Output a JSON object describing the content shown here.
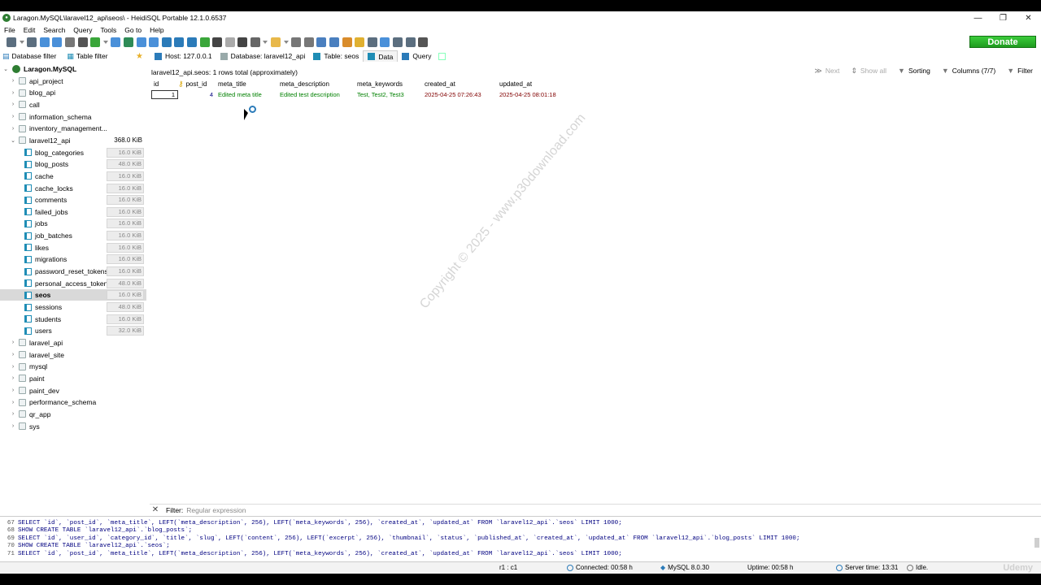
{
  "window": {
    "title": "Laragon.MySQL\\laravel12_api\\seos\\ - HeidiSQL Portable 12.1.0.6537"
  },
  "menu": [
    "File",
    "Edit",
    "Search",
    "Query",
    "Tools",
    "Go to",
    "Help"
  ],
  "toolbar": {
    "donate_label": "Donate",
    "icons": [
      {
        "name": "connect-icon",
        "color": "#5b6e7f"
      },
      {
        "name": "dropdown-icon",
        "color": "#888888"
      },
      {
        "name": "disconnect-icon",
        "color": "#5b6e7f"
      },
      {
        "name": "copy-icon",
        "color": "#4a90d9"
      },
      {
        "name": "paste-icon",
        "color": "#4a90d9"
      },
      {
        "name": "undo-icon",
        "color": "#777777"
      },
      {
        "name": "print-icon",
        "color": "#555555"
      },
      {
        "name": "refresh-icon",
        "color": "#3aa63a"
      },
      {
        "name": "dropdown-icon",
        "color": "#888888"
      },
      {
        "name": "user-manager-icon",
        "color": "#4a90d9"
      },
      {
        "name": "export-icon",
        "color": "#2e8b57"
      },
      {
        "name": "import-icon",
        "color": "#4a90d9"
      },
      {
        "name": "transfer-icon",
        "color": "#4a90d9"
      },
      {
        "name": "help-icon",
        "color": "#2b7bb9"
      },
      {
        "name": "first-icon",
        "color": "#2b7bb9"
      },
      {
        "name": "last-icon",
        "color": "#2b7bb9"
      },
      {
        "name": "add-icon",
        "color": "#3aa63a"
      },
      {
        "name": "delete-icon",
        "color": "#444444"
      },
      {
        "name": "post-icon",
        "color": "#aaaaaa"
      },
      {
        "name": "cancel-icon",
        "color": "#444444"
      },
      {
        "name": "run-icon",
        "color": "#666666"
      },
      {
        "name": "dropdown-icon",
        "color": "#888888"
      },
      {
        "name": "folder-icon",
        "color": "#e8b84a"
      },
      {
        "name": "dropdown-icon",
        "color": "#888888"
      },
      {
        "name": "save-icon",
        "color": "#777777"
      },
      {
        "name": "save-as-icon",
        "color": "#777777"
      },
      {
        "name": "search-icon",
        "color": "#4a7fbf"
      },
      {
        "name": "replace-icon",
        "color": "#4a7fbf"
      },
      {
        "name": "brush-icon",
        "color": "#d98c2b"
      },
      {
        "name": "warning-icon",
        "color": "#e0b030"
      },
      {
        "name": "binary-icon",
        "color": "#5b6e7f"
      },
      {
        "name": "wrap-icon",
        "color": "#4a90d9"
      },
      {
        "name": "transfer2-icon",
        "color": "#5b6e7f"
      },
      {
        "name": "more-icon",
        "color": "#5b6e7f"
      },
      {
        "name": "close-tab-icon",
        "color": "#555555"
      }
    ]
  },
  "filters": {
    "database_filter": "Database filter",
    "table_filter": "Table filter"
  },
  "tabs": [
    {
      "label": "Host: 127.0.0.1",
      "icon": "host-icon",
      "active": false
    },
    {
      "label": "Database: laravel12_api",
      "icon": "database-icon",
      "active": false
    },
    {
      "label": "Table: seos",
      "icon": "table-icon",
      "active": false
    },
    {
      "label": "Data",
      "icon": "data-icon",
      "active": true
    },
    {
      "label": "Query",
      "icon": "query-icon",
      "active": false
    }
  ],
  "tree": {
    "root": "Laragon.MySQL",
    "items": [
      {
        "label": "api_project",
        "type": "db",
        "expanded": false
      },
      {
        "label": "blog_api",
        "type": "db",
        "expanded": false
      },
      {
        "label": "call",
        "type": "db",
        "expanded": false
      },
      {
        "label": "information_schema",
        "type": "db",
        "expanded": false
      },
      {
        "label": "inventory_management...",
        "type": "db",
        "expanded": false
      },
      {
        "label": "laravel12_api",
        "type": "db",
        "expanded": true,
        "size": "368.0 KiB"
      },
      {
        "label": "blog_categories",
        "type": "table",
        "size": "16.0 KiB"
      },
      {
        "label": "blog_posts",
        "type": "table",
        "size": "48.0 KiB"
      },
      {
        "label": "cache",
        "type": "table",
        "size": "16.0 KiB"
      },
      {
        "label": "cache_locks",
        "type": "table",
        "size": "16.0 KiB"
      },
      {
        "label": "comments",
        "type": "table",
        "size": "16.0 KiB"
      },
      {
        "label": "failed_jobs",
        "type": "table",
        "size": "16.0 KiB"
      },
      {
        "label": "jobs",
        "type": "table",
        "size": "16.0 KiB"
      },
      {
        "label": "job_batches",
        "type": "table",
        "size": "16.0 KiB"
      },
      {
        "label": "likes",
        "type": "table",
        "size": "16.0 KiB"
      },
      {
        "label": "migrations",
        "type": "table",
        "size": "16.0 KiB"
      },
      {
        "label": "password_reset_tokens",
        "type": "table",
        "size": "16.0 KiB"
      },
      {
        "label": "personal_access_tokens",
        "type": "table",
        "size": "48.0 KiB"
      },
      {
        "label": "seos",
        "type": "table",
        "size": "16.0 KiB",
        "selected": true
      },
      {
        "label": "sessions",
        "type": "table",
        "size": "48.0 KiB"
      },
      {
        "label": "students",
        "type": "table",
        "size": "16.0 KiB"
      },
      {
        "label": "users",
        "type": "table",
        "size": "32.0 KiB"
      },
      {
        "label": "laravel_api",
        "type": "db",
        "expanded": false
      },
      {
        "label": "laravel_site",
        "type": "db",
        "expanded": false
      },
      {
        "label": "mysql",
        "type": "db",
        "expanded": false
      },
      {
        "label": "paint",
        "type": "db",
        "expanded": false
      },
      {
        "label": "paint_dev",
        "type": "db",
        "expanded": false
      },
      {
        "label": "performance_schema",
        "type": "db",
        "expanded": false
      },
      {
        "label": "qr_app",
        "type": "db",
        "expanded": false
      },
      {
        "label": "sys",
        "type": "db",
        "expanded": false
      }
    ]
  },
  "data_grid": {
    "row_count": "laravel12_api.seos: 1 rows total (approximately)",
    "tools": {
      "next": "Next",
      "show_all": "Show all",
      "sorting": "Sorting",
      "columns": "Columns (7/7)",
      "filter": "Filter"
    },
    "columns": [
      "id",
      "post_id",
      "meta_title",
      "meta_description",
      "meta_keywords",
      "created_at",
      "updated_at"
    ],
    "rows": [
      [
        "1",
        "4",
        "Edited meta title",
        "Edited test description",
        "Test, Test2, Test3",
        "2025-04-25 07:26:43",
        "2025-04-25 08:01:18"
      ]
    ]
  },
  "watermark": "Copyright © 2025 - www.p30download.com",
  "bottom_filter": {
    "label": "Filter:",
    "placeholder": "Regular expression"
  },
  "query_log": [
    {
      "num": "67",
      "text": "SELECT `id`, `post_id`, `meta_title`, LEFT(`meta_description`, 256), LEFT(`meta_keywords`, 256), `created_at`, `updated_at` FROM `laravel12_api`.`seos` LIMIT 1000;"
    },
    {
      "num": "68",
      "text": "SHOW CREATE TABLE `laravel12_api`.`blog_posts`;"
    },
    {
      "num": "69",
      "text": "SELECT `id`, `user_id`, `category_id`, `title`, `slug`, LEFT(`content`, 256), LEFT(`excerpt`, 256), `thumbnail`, `status`, `published_at`, `created_at`, `updated_at` FROM `laravel12_api`.`blog_posts` LIMIT 1000;"
    },
    {
      "num": "70",
      "text": "SHOW CREATE TABLE `laravel12_api`.`seos`;"
    },
    {
      "num": "71",
      "text": "SELECT `id`, `post_id`, `meta_title`, LEFT(`meta_description`, 256), LEFT(`meta_keywords`, 256), `created_at`, `updated_at` FROM `laravel12_api`.`seos` LIMIT 1000;"
    }
  ],
  "status": {
    "cursor": "r1 : c1",
    "connected": "Connected: 00:58 h",
    "server": "MySQL 8.0.30",
    "uptime": "Uptime: 00:58 h",
    "server_time": "Server time: 13:31",
    "state": "Idle.",
    "brand": "Udemy"
  }
}
